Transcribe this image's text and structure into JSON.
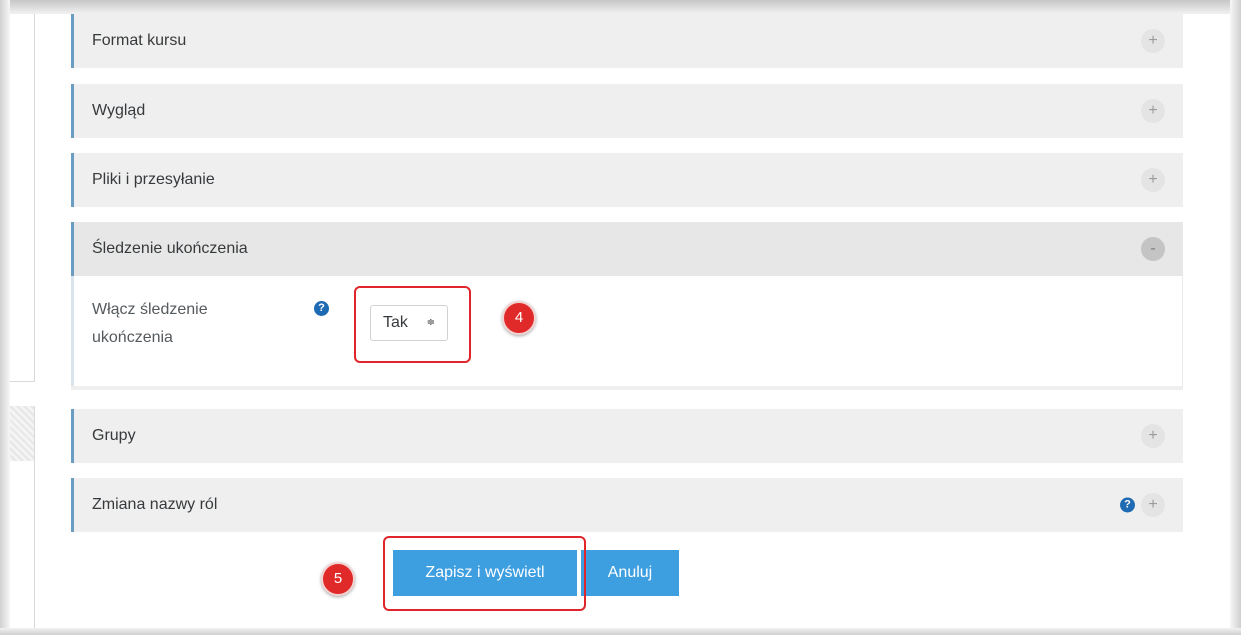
{
  "sections": [
    {
      "title": "Format kursu",
      "toggle": "+"
    },
    {
      "title": "Wygląd",
      "toggle": "+"
    },
    {
      "title": "Pliki i przesyłanie",
      "toggle": "+"
    },
    {
      "title": "Śledzenie ukończenia",
      "toggle": "-"
    },
    {
      "title": "Grupy",
      "toggle": "+"
    },
    {
      "title": "Zmiana nazwy ról",
      "toggle": "+"
    }
  ],
  "completion": {
    "label_line1": "Włącz śledzenie",
    "label_line2": "ukończenia",
    "select_value": "Tak",
    "select_arrows": "≑"
  },
  "help_icon_glyph": "?",
  "markers": {
    "step4": "4",
    "step5": "5"
  },
  "buttons": {
    "save": "Zapisz i wyświetl",
    "cancel": "Anuluj"
  },
  "colors": {
    "accent_border": "#6b9dc2",
    "button": "#3d9ee0",
    "highlight": "#e0252b",
    "help_icon": "#1f6bb3"
  }
}
